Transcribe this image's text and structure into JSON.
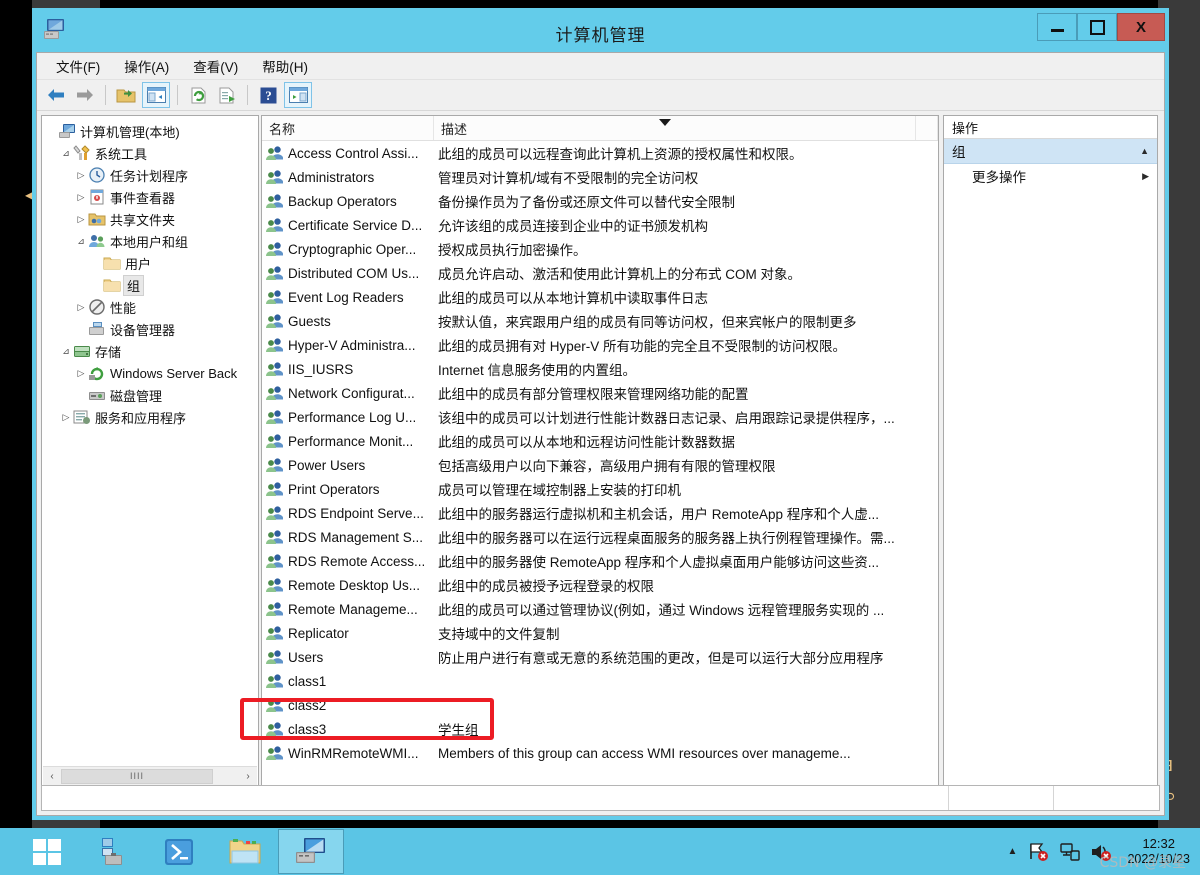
{
  "window": {
    "title": "计算机管理",
    "app_icon": "computer-management-icon",
    "buttons": {
      "minimize": "minimize-button",
      "maximize": "maximize-button",
      "close": "X"
    }
  },
  "menubar": [
    {
      "label": "文件(F)"
    },
    {
      "label": "操作(A)"
    },
    {
      "label": "查看(V)"
    },
    {
      "label": "帮助(H)"
    }
  ],
  "toolbar": [
    {
      "icon": "back-arrow-icon",
      "framed": false
    },
    {
      "icon": "forward-arrow-icon",
      "framed": false
    },
    {
      "icon": "up-folder-icon",
      "framed": false
    },
    {
      "icon": "show-hide-console-tree-icon",
      "framed": true
    },
    {
      "icon": "refresh-icon",
      "framed": false
    },
    {
      "icon": "export-list-icon",
      "framed": false
    },
    {
      "icon": "help-icon",
      "framed": false
    },
    {
      "icon": "show-hide-action-pane-icon",
      "framed": true
    }
  ],
  "tree": {
    "nodes": [
      {
        "label": "计算机管理(本地)",
        "indent": 0,
        "expander": "",
        "icon": "computer-icon",
        "selected": false
      },
      {
        "label": "系统工具",
        "indent": 1,
        "expander": "▲",
        "icon": "tools-icon",
        "selected": false
      },
      {
        "label": "任务计划程序",
        "indent": 2,
        "expander": "▷",
        "icon": "clock-icon",
        "selected": false
      },
      {
        "label": "事件查看器",
        "indent": 2,
        "expander": "▷",
        "icon": "event-viewer-icon",
        "selected": false
      },
      {
        "label": "共享文件夹",
        "indent": 2,
        "expander": "▷",
        "icon": "shared-folder-icon",
        "selected": false
      },
      {
        "label": "本地用户和组",
        "indent": 2,
        "expander": "▲",
        "icon": "users-groups-icon",
        "selected": false
      },
      {
        "label": "用户",
        "indent": 3,
        "expander": "",
        "icon": "folder-icon",
        "selected": false
      },
      {
        "label": "组",
        "indent": 3,
        "expander": "",
        "icon": "folder-icon",
        "selected": true
      },
      {
        "label": "性能",
        "indent": 2,
        "expander": "▷",
        "icon": "performance-icon",
        "selected": false
      },
      {
        "label": "设备管理器",
        "indent": 2,
        "expander": "",
        "icon": "device-manager-icon",
        "selected": false
      },
      {
        "label": "存储",
        "indent": 1,
        "expander": "▲",
        "icon": "storage-icon",
        "selected": false
      },
      {
        "label": "Windows Server Back",
        "indent": 2,
        "expander": "▷",
        "icon": "backup-icon",
        "selected": false
      },
      {
        "label": "磁盘管理",
        "indent": 2,
        "expander": "",
        "icon": "disk-management-icon",
        "selected": false
      },
      {
        "label": "服务和应用程序",
        "indent": 1,
        "expander": "▷",
        "icon": "services-icon",
        "selected": false
      }
    ],
    "scrollbar": {
      "left_arrow": "‹",
      "right_arrow": "›",
      "thumb_glyph": "IIII"
    }
  },
  "list": {
    "columns": [
      {
        "label": "名称"
      },
      {
        "label": "描述"
      }
    ],
    "sort_indicator": "descending-sort-icon",
    "rows": [
      {
        "name": "Access Control Assi...",
        "desc": "此组的成员可以远程查询此计算机上资源的授权属性和权限。"
      },
      {
        "name": "Administrators",
        "desc": "管理员对计算机/域有不受限制的完全访问权"
      },
      {
        "name": "Backup Operators",
        "desc": "备份操作员为了备份或还原文件可以替代安全限制"
      },
      {
        "name": "Certificate Service D...",
        "desc": "允许该组的成员连接到企业中的证书颁发机构"
      },
      {
        "name": "Cryptographic Oper...",
        "desc": "授权成员执行加密操作。"
      },
      {
        "name": "Distributed COM Us...",
        "desc": "成员允许启动、激活和使用此计算机上的分布式 COM 对象。"
      },
      {
        "name": "Event Log Readers",
        "desc": "此组的成员可以从本地计算机中读取事件日志"
      },
      {
        "name": "Guests",
        "desc": "按默认值，来宾跟用户组的成员有同等访问权，但来宾帐户的限制更多"
      },
      {
        "name": "Hyper-V Administra...",
        "desc": "此组的成员拥有对 Hyper-V 所有功能的完全且不受限制的访问权限。"
      },
      {
        "name": "IIS_IUSRS",
        "desc": "Internet 信息服务使用的内置组。"
      },
      {
        "name": "Network Configurat...",
        "desc": "此组中的成员有部分管理权限来管理网络功能的配置"
      },
      {
        "name": "Performance Log U...",
        "desc": "该组中的成员可以计划进行性能计数器日志记录、启用跟踪记录提供程序，..."
      },
      {
        "name": "Performance Monit...",
        "desc": "此组的成员可以从本地和远程访问性能计数器数据"
      },
      {
        "name": "Power Users",
        "desc": "包括高级用户以向下兼容，高级用户拥有有限的管理权限"
      },
      {
        "name": "Print Operators",
        "desc": "成员可以管理在域控制器上安装的打印机"
      },
      {
        "name": "RDS Endpoint Serve...",
        "desc": "此组中的服务器运行虚拟机和主机会话，用户 RemoteApp 程序和个人虚..."
      },
      {
        "name": "RDS Management S...",
        "desc": "此组中的服务器可以在运行远程桌面服务的服务器上执行例程管理操作。需..."
      },
      {
        "name": "RDS Remote Access...",
        "desc": "此组中的服务器使 RemoteApp 程序和个人虚拟桌面用户能够访问这些资..."
      },
      {
        "name": "Remote Desktop Us...",
        "desc": "此组中的成员被授予远程登录的权限"
      },
      {
        "name": "Remote Manageme...",
        "desc": "此组的成员可以通过管理协议(例如，通过 Windows 远程管理服务实现的 ..."
      },
      {
        "name": "Replicator",
        "desc": "支持域中的文件复制"
      },
      {
        "name": "Users",
        "desc": "防止用户进行有意或无意的系统范围的更改，但是可以运行大部分应用程序"
      },
      {
        "name": "class1",
        "desc": ""
      },
      {
        "name": "class2",
        "desc": ""
      },
      {
        "name": "class3",
        "desc": "学生组"
      },
      {
        "name": "WinRMRemoteWMI...",
        "desc": "Members of this group can access WMI resources over manageme..."
      }
    ]
  },
  "actions": {
    "header": "操作",
    "group_title": "组",
    "group_collapse_icon": "chevron-up-icon",
    "items": [
      {
        "label": "更多操作",
        "arrow": "▶"
      }
    ]
  },
  "annotation": {
    "color": "#ec1c24",
    "target": "class3"
  },
  "taskbar": {
    "apps": [
      {
        "name": "start-button",
        "icon": "windows-logo-icon",
        "active": false
      },
      {
        "name": "server-manager",
        "icon": "server-manager-icon",
        "active": false
      },
      {
        "name": "powershell",
        "icon": "powershell-icon",
        "active": false
      },
      {
        "name": "file-explorer",
        "icon": "file-explorer-icon",
        "active": false
      },
      {
        "name": "computer-management",
        "icon": "computer-management-icon",
        "active": true
      }
    ],
    "tray": {
      "show_hidden": "▲",
      "icons": [
        "network-error-icon",
        "action-center-icon",
        "volume-muted-icon"
      ],
      "time": "12:32",
      "date": "2022/10/23"
    },
    "watermark": "CSDN @录星"
  }
}
